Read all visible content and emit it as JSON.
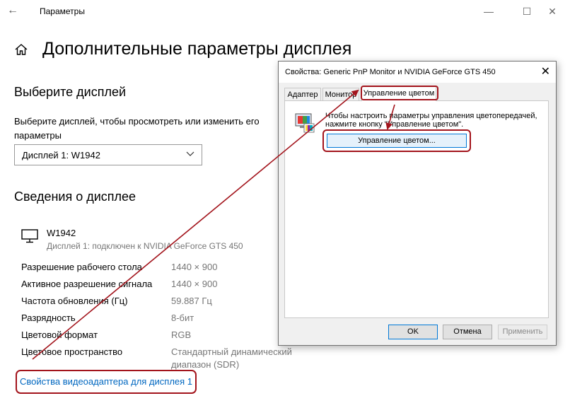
{
  "window": {
    "title": "Параметры",
    "back_glyph": "←",
    "minimize_glyph": "—",
    "maximize_glyph": "☐",
    "close_glyph": "✕"
  },
  "page": {
    "title": "Дополнительные параметры дисплея",
    "select_heading": "Выберите дисплей",
    "select_description": "Выберите дисплей, чтобы просмотреть или изменить его параметры",
    "dropdown_value": "Дисплей 1: W1942",
    "info_heading": "Сведения о дисплее",
    "monitor_name": "W1942",
    "monitor_connection": "Дисплей 1: подключен к NVIDIA GeForce GTS 450",
    "properties": [
      {
        "label": "Разрешение рабочего стола",
        "value": "1440 × 900"
      },
      {
        "label": "Активное разрешение сигнала",
        "value": "1440 × 900"
      },
      {
        "label": "Частота обновления (Гц)",
        "value": "59.887 Гц"
      },
      {
        "label": "Разрядность",
        "value": "8-бит"
      },
      {
        "label": "Цветовой формат",
        "value": "RGB"
      },
      {
        "label": "Цветовое пространство",
        "value": "Стандартный динамический диапазон (SDR)"
      }
    ],
    "adapter_link": "Свойства видеоадаптера для дисплея 1"
  },
  "dialog": {
    "title": "Свойства: Generic PnP Monitor и NVIDIA GeForce GTS 450",
    "close_glyph": "✕",
    "tabs": [
      "Адаптер",
      "Монитор",
      "Управление цветом"
    ],
    "description": "Чтобы настроить параметры управления цветопередачей, нажмите кнопку \"Управление цветом\".",
    "color_button": "Управление цветом...",
    "ok": "OK",
    "cancel": "Отмена",
    "apply": "Применить"
  },
  "colors": {
    "annotation": "#a3141c",
    "link": "#0067c0",
    "accent": "#0078d7"
  },
  "icons": [
    "back-arrow-icon",
    "home-icon",
    "chevron-down-icon",
    "monitor-icon",
    "color-management-icon",
    "close-icon"
  ]
}
